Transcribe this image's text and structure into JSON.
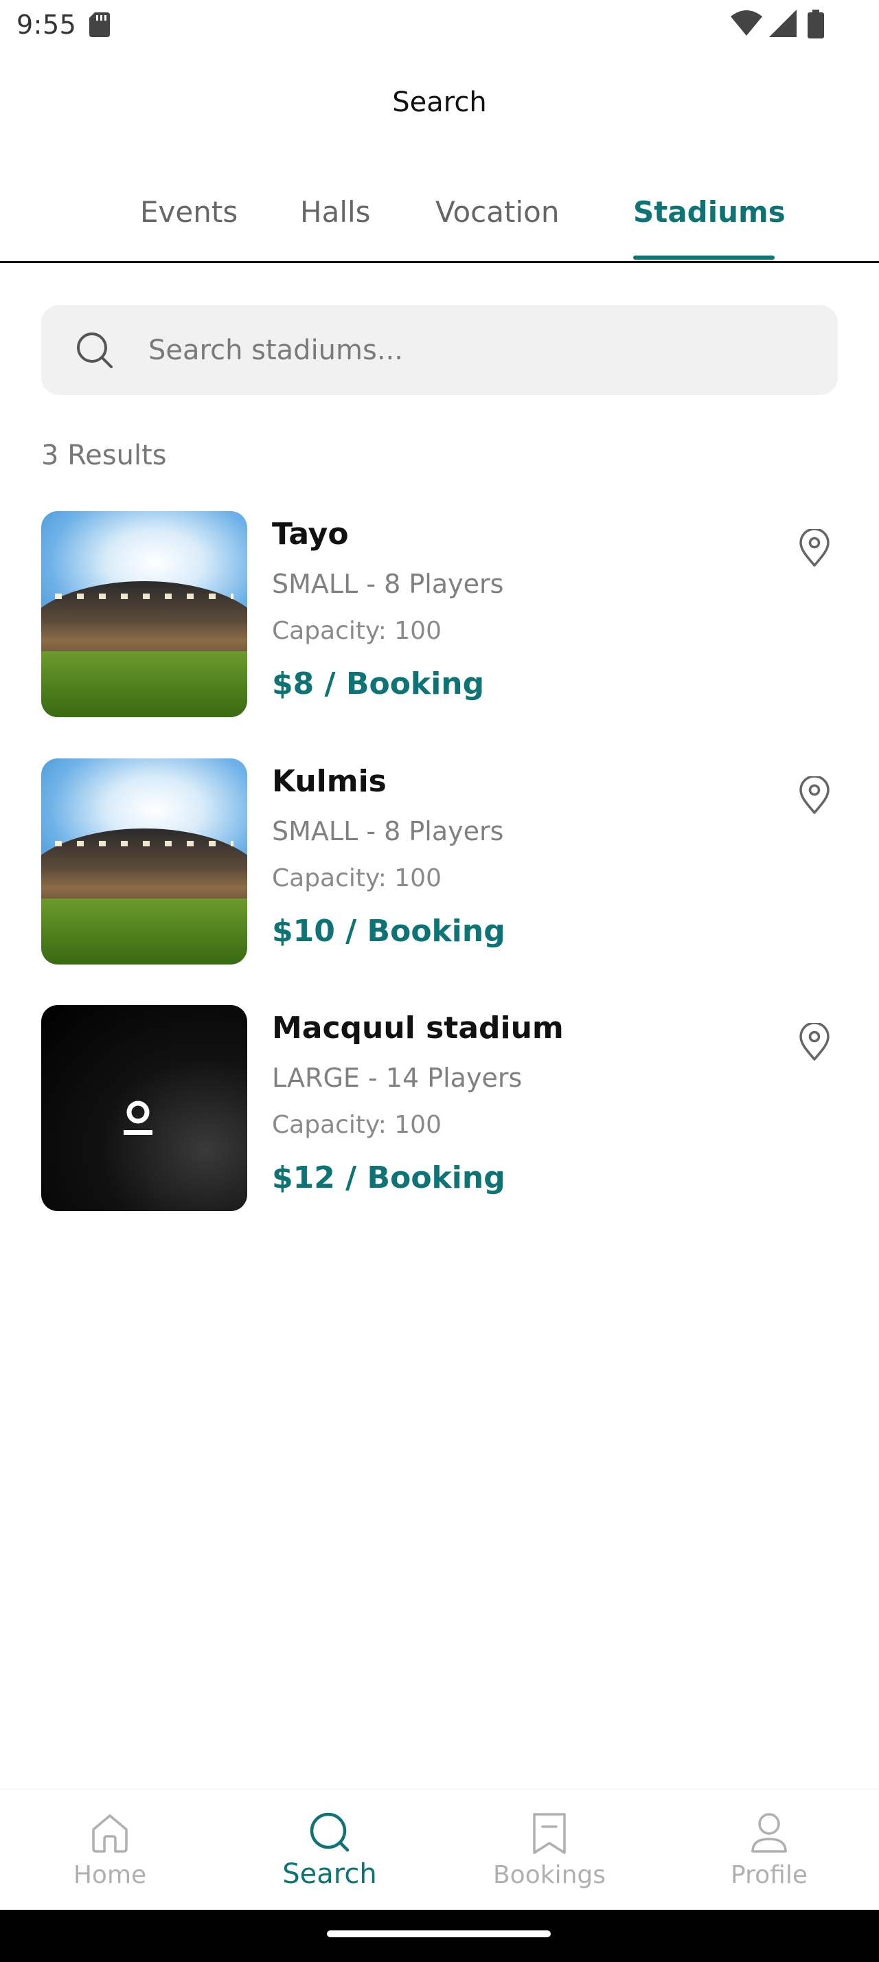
{
  "status_bar": {
    "time": "9:55"
  },
  "header": {
    "title": "Search"
  },
  "tabs": [
    {
      "label": "Events",
      "active": false
    },
    {
      "label": "Halls",
      "active": false
    },
    {
      "label": "Vocation",
      "active": false
    },
    {
      "label": "Stadiums",
      "active": true
    }
  ],
  "search": {
    "placeholder": "Search stadiums...",
    "value": ""
  },
  "results": {
    "count_label": "3 Results",
    "items": [
      {
        "name": "Tayo",
        "size": "SMALL - 8 Players",
        "capacity": "Capacity: 100",
        "price": "$8 / Booking",
        "image": "stadium-photo"
      },
      {
        "name": "Kulmis",
        "size": "SMALL - 8 Players",
        "capacity": "Capacity: 100",
        "price": "$10 / Booking",
        "image": "stadium-photo"
      },
      {
        "name": "Macquul stadium",
        "size": "LARGE - 14 Players",
        "capacity": "Capacity: 100",
        "price": "$12 / Booking",
        "image": "dark-logo-image"
      }
    ]
  },
  "bottom_nav": [
    {
      "label": "Home",
      "icon": "home-icon",
      "active": false
    },
    {
      "label": "Search",
      "icon": "search-icon",
      "active": true
    },
    {
      "label": "Bookings",
      "icon": "bookmark-icon",
      "active": false
    },
    {
      "label": "Profile",
      "icon": "profile-icon",
      "active": false
    }
  ],
  "colors": {
    "accent": "#0e7374",
    "muted_text": "#808080",
    "search_bg": "#f1f1f1"
  }
}
